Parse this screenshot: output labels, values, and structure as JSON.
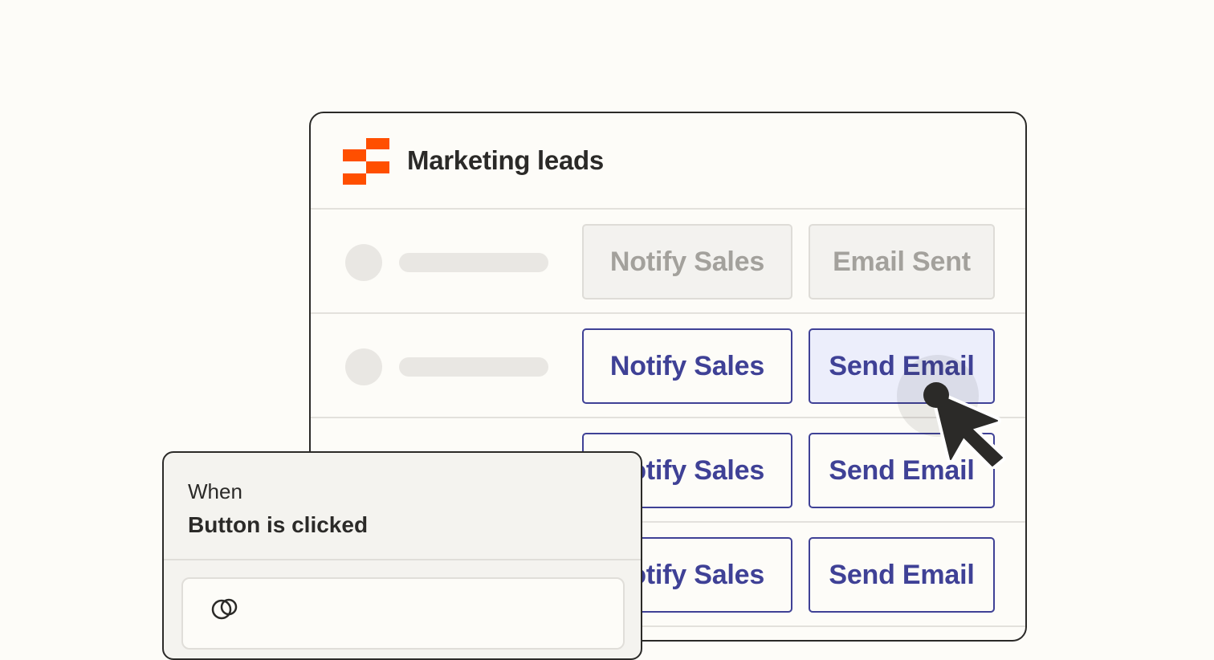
{
  "card": {
    "title": "Marketing leads",
    "brand_color": "#ff4f00"
  },
  "rows": [
    {
      "notify_label": "Notify Sales",
      "email_label": "Email Sent",
      "state": "disabled"
    },
    {
      "notify_label": "Notify Sales",
      "email_label": "Send Email",
      "state": "active-hovered"
    },
    {
      "notify_label": "Notify Sales",
      "email_label": "Send Email",
      "state": "active"
    },
    {
      "notify_label": "Notify Sales",
      "email_label": "Send Email",
      "state": "active"
    }
  ],
  "colors": {
    "accent": "#3f4196",
    "disabled_text": "#a3a19c",
    "border": "#2b2a28",
    "hover_fill": "#eceefb"
  },
  "trigger_panel": {
    "label": "When",
    "value": "Button is clicked",
    "icon": "app-icon"
  },
  "cursor": {
    "icon": "arrow-cursor-icon"
  }
}
